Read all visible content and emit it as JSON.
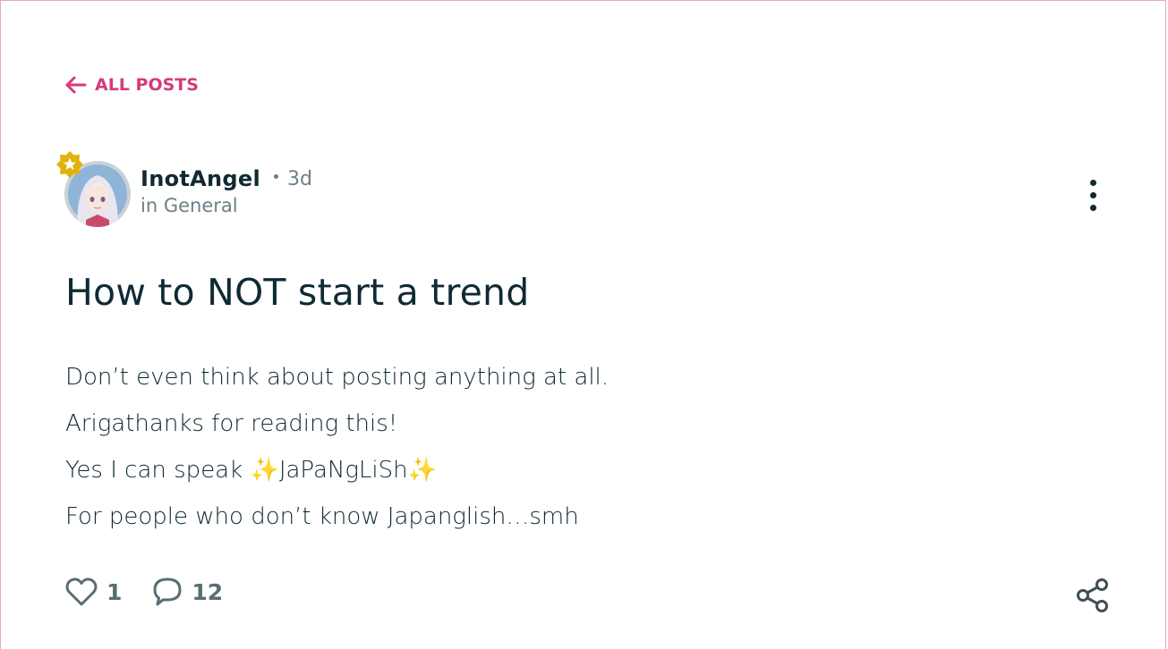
{
  "nav": {
    "back_label": "ALL POSTS"
  },
  "post": {
    "author": "InotAngel",
    "age": "3d",
    "category": "in General",
    "title": "How to NOT start a trend",
    "body": {
      "line1": "Don’t even think about posting anything at all.",
      "line2": "Arigathanks for reading this!",
      "line3_pre": "Yes I can speak ",
      "line3_word": "JaPaNgLiSh",
      "line4": "For people who don’t know Japanglish…smh"
    },
    "sparkle_glyph": "✨",
    "likes": "1",
    "comments": "12"
  },
  "icons": {
    "back": "arrow-left-icon",
    "badge": "star-badge-icon",
    "more": "more-vertical-icon",
    "like": "heart-icon",
    "comment": "comment-icon",
    "share": "share-icon"
  },
  "colors": {
    "accent": "#d63a7a",
    "text": "#0f2a33",
    "muted": "#6d7f86",
    "badge": "#e0b20c"
  }
}
